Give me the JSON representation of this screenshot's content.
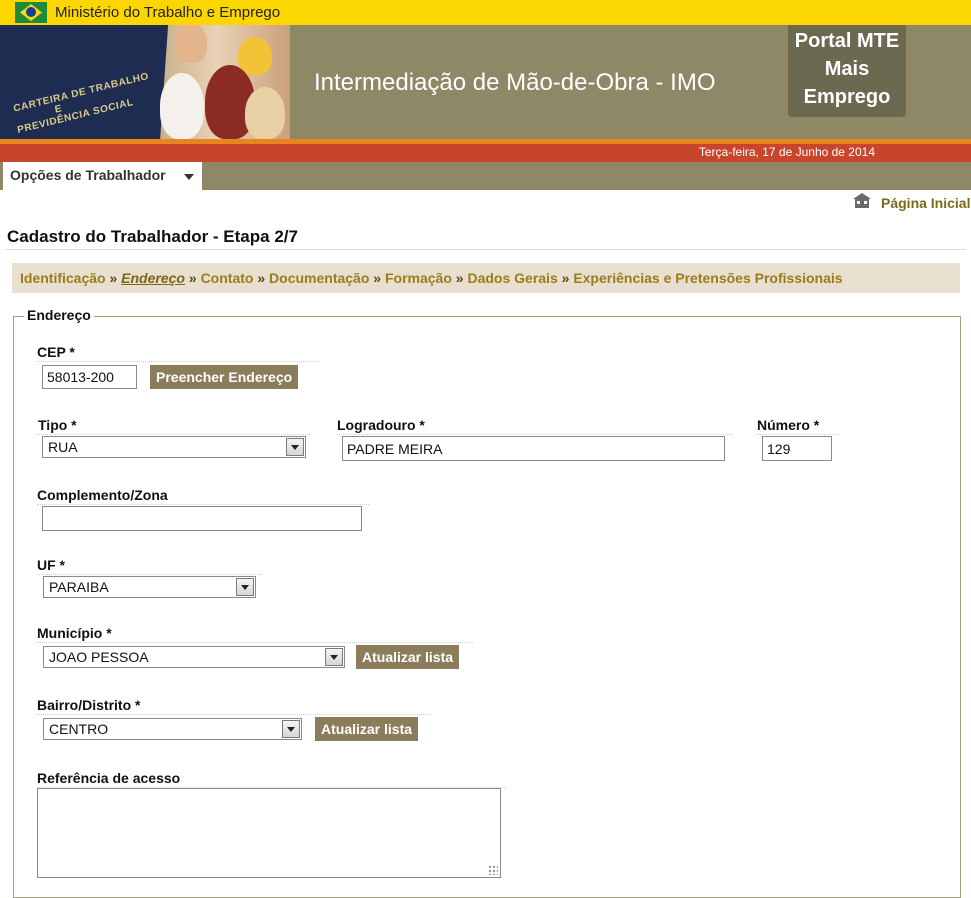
{
  "gov_bar": {
    "title": "Ministério do Trabalho e Emprego"
  },
  "banner": {
    "booklet_text": [
      "CARTEIRA DE TRABALHO",
      "E",
      "PREVIDÊNCIA SOCIAL"
    ],
    "title": "Intermediação de Mão-de-Obra - IMO",
    "portal_lines": [
      "Portal MTE",
      "Mais",
      "Emprego"
    ]
  },
  "date": "Terça-feira, 17 de Junho de 2014",
  "nav": {
    "menu_label": "Opções de Trabalhador"
  },
  "home_link": "Página Inicial",
  "page_title": "Cadastro do Trabalhador - Etapa 2/7",
  "breadcrumb": {
    "steps": [
      "Identificação",
      "Endereço",
      "Contato",
      "Documentação",
      "Formação",
      "Dados Gerais",
      "Experiências e Pretensões Profissionais"
    ],
    "separator": "»",
    "current": "Endereço"
  },
  "form": {
    "legend": "Endereço",
    "cep": {
      "label": "CEP *",
      "value": "58013-200",
      "button": "Preencher Endereço"
    },
    "tipo": {
      "label": "Tipo *",
      "value": "RUA"
    },
    "logradouro": {
      "label": "Logradouro *",
      "value": "PADRE MEIRA"
    },
    "numero": {
      "label": "Número *",
      "value": "129"
    },
    "complemento": {
      "label": "Complemento/Zona",
      "value": ""
    },
    "uf": {
      "label": "UF *",
      "value": "PARAIBA"
    },
    "municipio": {
      "label": "Município *",
      "value": "JOAO PESSOA",
      "button": "Atualizar lista"
    },
    "bairro": {
      "label": "Bairro/Distrito *",
      "value": "CENTRO",
      "button": "Atualizar lista"
    },
    "referencia": {
      "label": "Referência de acesso",
      "value": ""
    }
  },
  "colors": {
    "gov_bar": "#fcd600",
    "banner": "#8e8866",
    "accent_red": "#c8442a",
    "link": "#9a7d1a",
    "button": "#8c7d5a"
  }
}
